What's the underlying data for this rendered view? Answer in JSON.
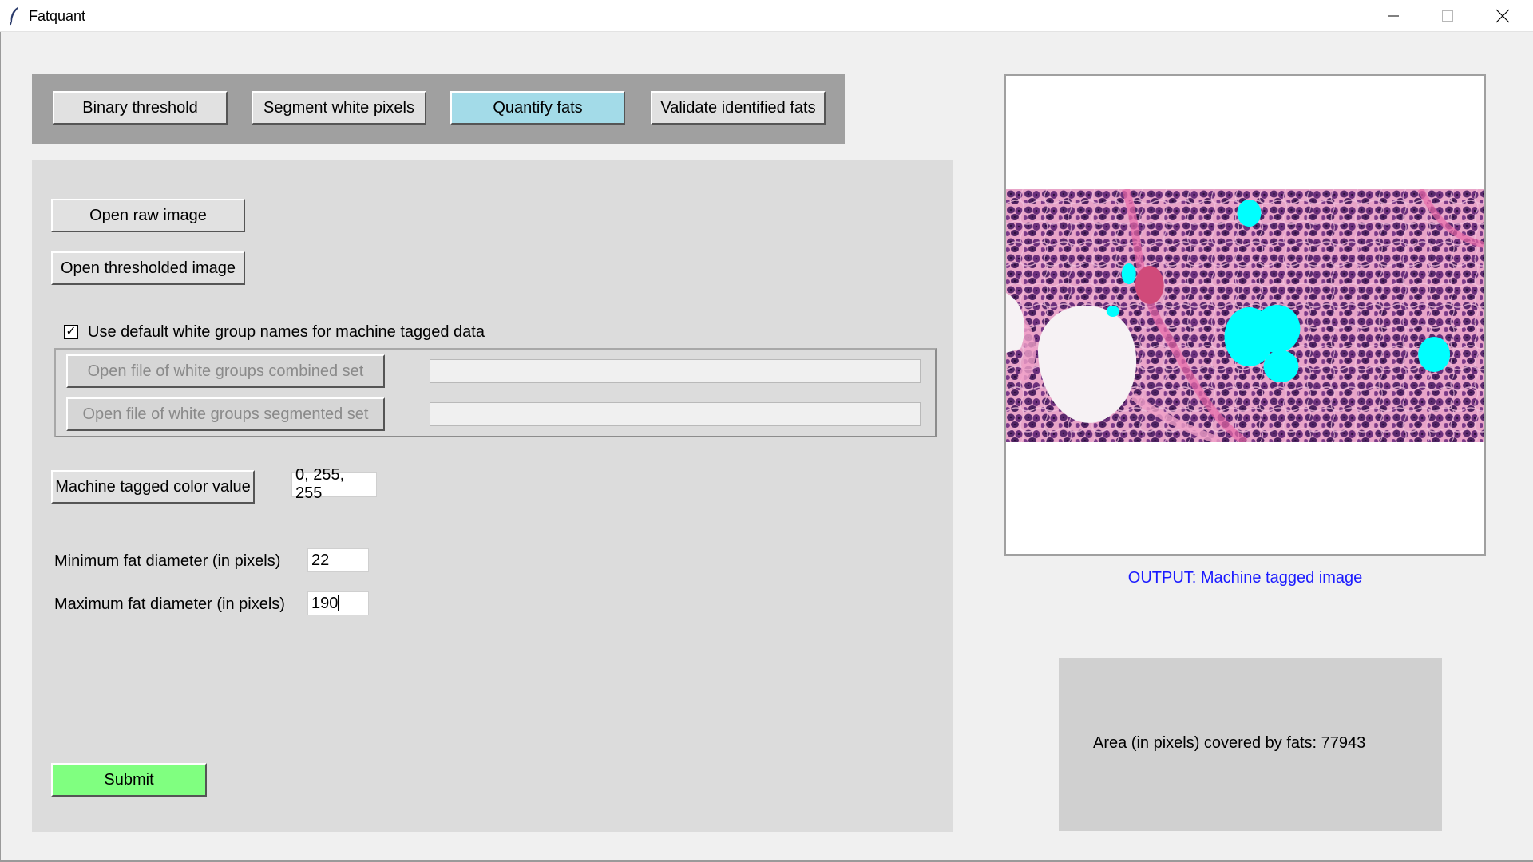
{
  "window": {
    "title": "Fatquant",
    "icon": "feather-icon"
  },
  "tabs": [
    {
      "label": "Binary threshold",
      "active": false
    },
    {
      "label": "Segment white pixels",
      "active": false
    },
    {
      "label": "Quantify fats",
      "active": true
    },
    {
      "label": "Validate identified fats",
      "active": false
    }
  ],
  "main": {
    "open_raw_label": "Open raw image",
    "open_thresholded_label": "Open thresholded image",
    "checkbox": {
      "label": "Use default white group names for machine tagged data",
      "checked": true,
      "mark": "✓"
    },
    "combined_set_label": "Open file of white groups combined set",
    "combined_set_value": "",
    "segmented_set_label": "Open file of white groups segmented set",
    "segmented_set_value": "",
    "color_button_label": "Machine tagged color value",
    "color_value": "0, 255, 255",
    "min_diameter_label": "Minimum fat diameter (in pixels)",
    "min_diameter_value": "22",
    "max_diameter_label": "Maximum fat diameter (in pixels)",
    "max_diameter_value": "190",
    "submit_label": "Submit"
  },
  "output": {
    "caption": "OUTPUT: Machine tagged image",
    "caption_color": "#1a1aff",
    "tag_color": "#00ffff"
  },
  "result": {
    "text": "Area (in pixels) covered by fats: 77943"
  },
  "colors": {
    "active_tab": "#a3dbe8",
    "submit": "#80ff80"
  }
}
